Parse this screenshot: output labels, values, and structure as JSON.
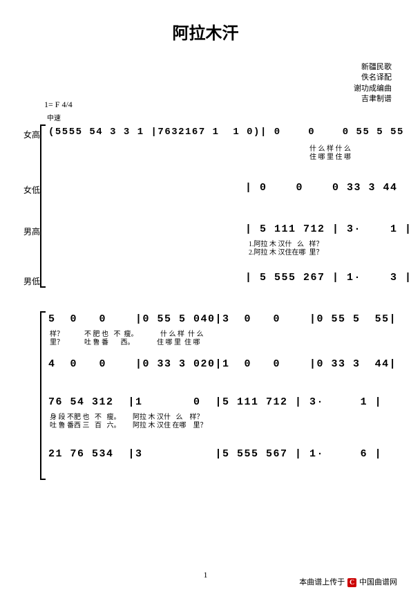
{
  "title": "阿拉木汗",
  "credits": [
    "新疆民歌",
    "佚名译配",
    "谢功成编曲",
    "吉聿制谱"
  ],
  "key": "1= F 4/4",
  "tempo": "中速",
  "parts": {
    "soprano": "女高",
    "alto": "女低",
    "tenor": "男高",
    "bass": "男低"
  },
  "system1": {
    "soprano": "(5555 54 3 3 1 |7632167 1  1 0)| 0    0    0 55 5 55",
    "soprano_lyr1": "什 么 样 什 么",
    "soprano_lyr2": "住 哪 里 住 哪",
    "alto": "| 0    0    0 33 3 44",
    "tenor": "| 5 111 712 | 3·    1 |",
    "tenor_lyr1": "1.阿拉 木 汉什   么   样？",
    "tenor_lyr2": "2.阿拉 木 汉住在哪  里？",
    "bass": "| 5 555 267 | 1·    3 |"
  },
  "system2": {
    "line1": "5  0   0    |0 55 5 040|3  0   0    |0 55 5  55|",
    "line1_lyr1": "样？            不 肥 也   不  瘦。             什 么 样  什 么",
    "line1_lyr2": "里？            吐 鲁 番       西。             住 哪 里  住 哪",
    "line2": "4  0   0    |0 33 3 020|1  0   0    |0 33 3  44|",
    "line3": "76 54 312  |1       0  |5 111 712 | 3·     1 |",
    "line3_lyr1": "身 段 不肥 也   不   瘦。       阿拉 木 汉什   么    样？",
    "line3_lyr2": "吐 鲁 番西 三   百   六。       阿拉 木 汉住 在哪    里？",
    "line4": "21 76 534  |3          |5 555 567 | 1·     6 |"
  },
  "pagenum": "1",
  "footer_text": "本曲谱上传于",
  "footer_brand": "中国曲谱网"
}
